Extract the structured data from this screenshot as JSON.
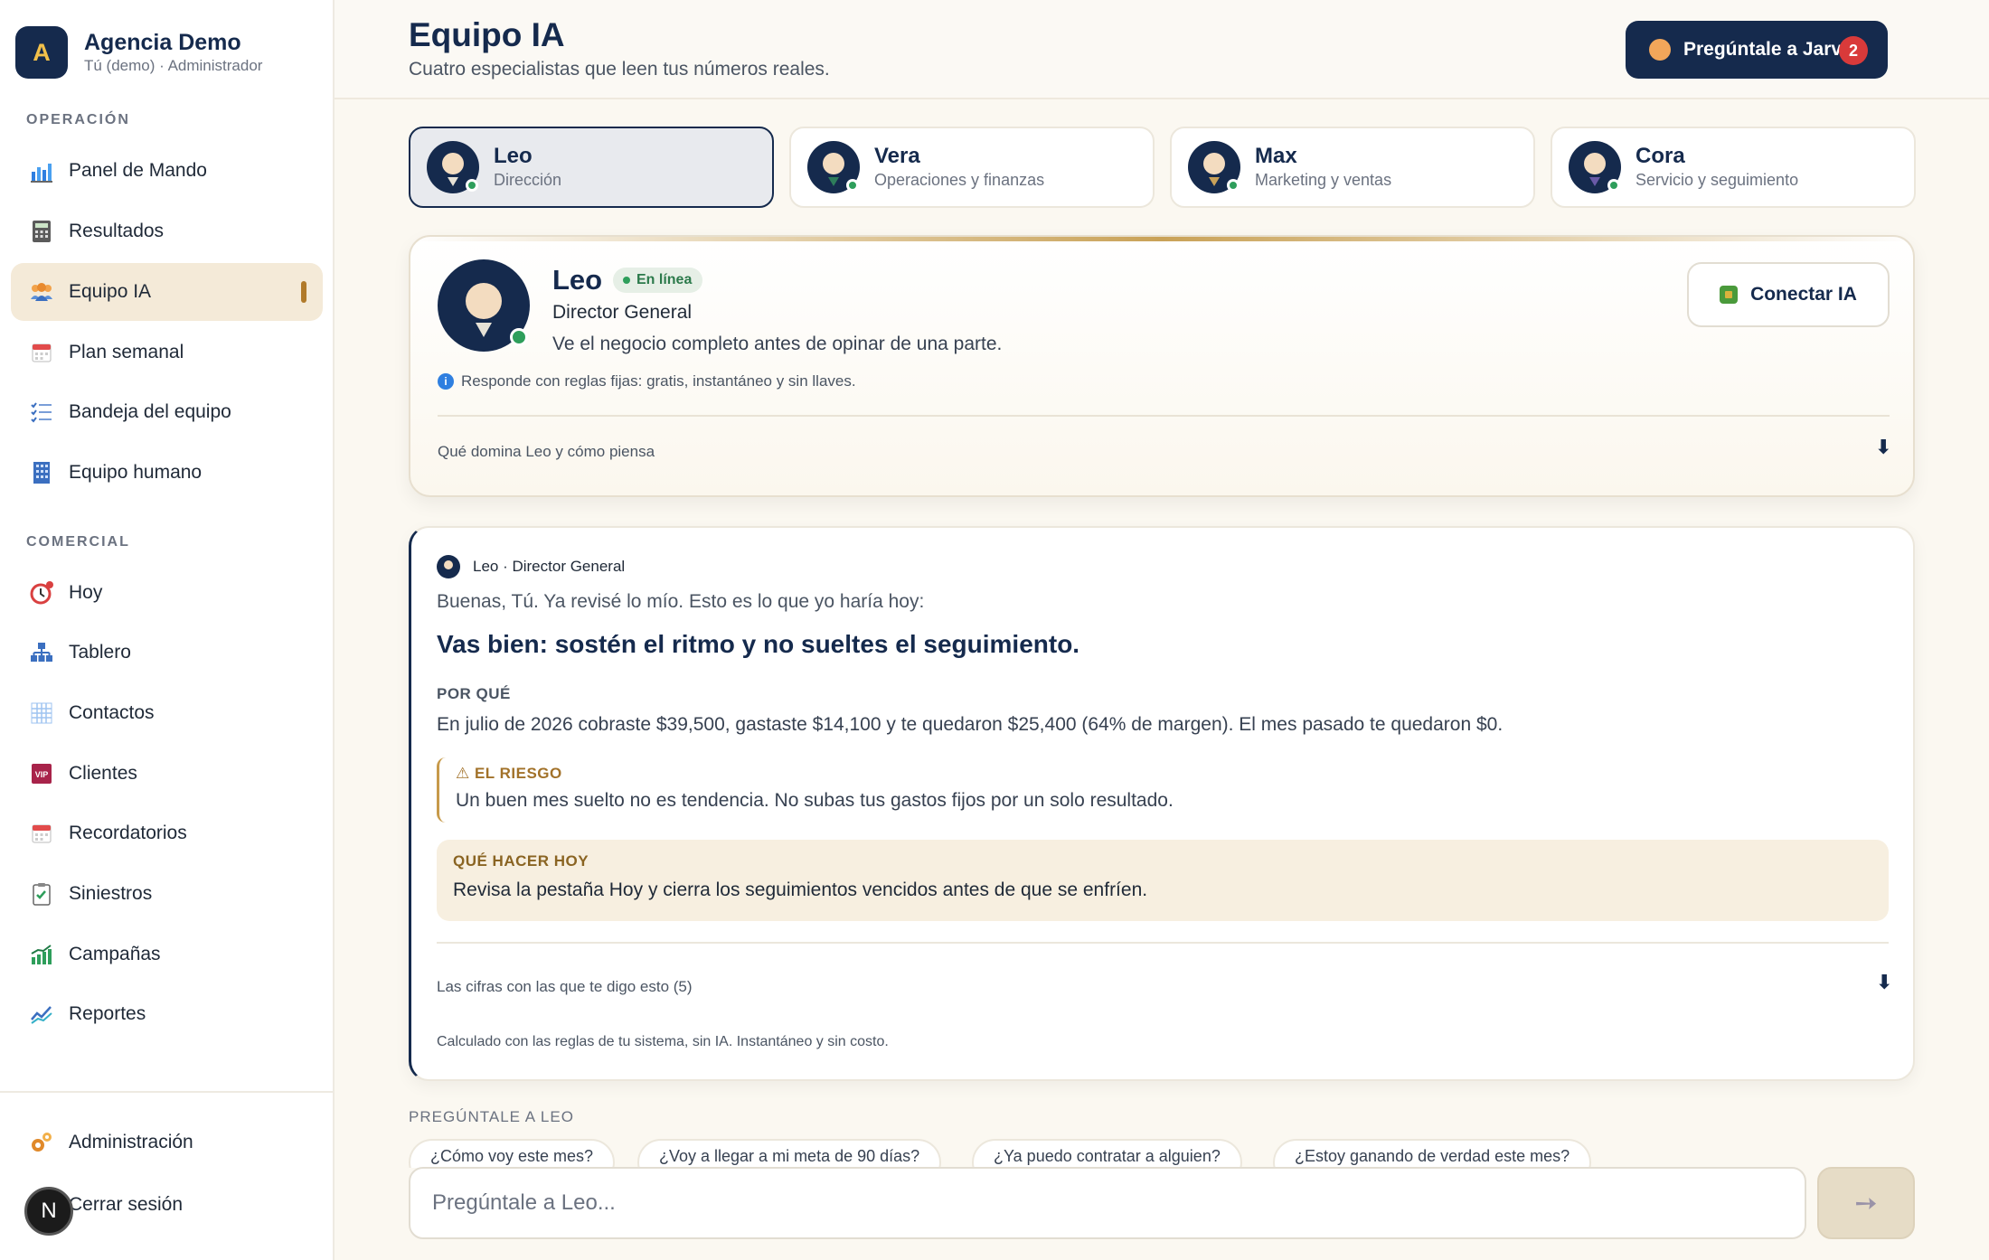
{
  "brand": {
    "logo_letter": "A",
    "name": "Agencia Demo",
    "user": "Tú (demo) · Administrador"
  },
  "sidebar": {
    "section_operacion": "OPERACIÓN",
    "section_comercial": "COMERCIAL",
    "operacion_items": [
      {
        "label": "Panel de Mando",
        "icon": "bar-chart-icon"
      },
      {
        "label": "Resultados",
        "icon": "calculator-icon"
      },
      {
        "label": "Equipo IA",
        "icon": "team-icon",
        "active": true
      },
      {
        "label": "Plan semanal",
        "icon": "calendar-icon"
      },
      {
        "label": "Bandeja del equipo",
        "icon": "checklist-icon"
      },
      {
        "label": "Equipo humano",
        "icon": "building-icon"
      }
    ],
    "comercial_items": [
      {
        "label": "Hoy",
        "icon": "alarm-clock-icon"
      },
      {
        "label": "Tablero",
        "icon": "org-chart-icon"
      },
      {
        "label": "Contactos",
        "icon": "grid-icon"
      },
      {
        "label": "Clientes",
        "icon": "vip-icon"
      },
      {
        "label": "Recordatorios",
        "icon": "calendar-icon"
      },
      {
        "label": "Siniestros",
        "icon": "clipboard-check-icon"
      },
      {
        "label": "Campañas",
        "icon": "growth-chart-icon"
      },
      {
        "label": "Reportes",
        "icon": "line-chart-icon"
      }
    ],
    "bottom": {
      "admin_label": "Administración",
      "logout_label": "Cerrar sesión",
      "avatar_letter": "N"
    }
  },
  "header": {
    "title": "Equipo IA",
    "subtitle": "Cuatro especialistas que leen tus números reales.",
    "jarvis_label": "Pregúntale a Jarvis",
    "jarvis_badge": "2"
  },
  "agents": [
    {
      "name": "Leo",
      "role": "Dirección",
      "active": true,
      "accent": "#6d8aa8"
    },
    {
      "name": "Vera",
      "role": "Operaciones y finanzas",
      "accent": "#2e7d5b"
    },
    {
      "name": "Max",
      "role": "Marketing y ventas",
      "accent": "#c9a25a"
    },
    {
      "name": "Cora",
      "role": "Servicio y seguimiento",
      "accent": "#6a5aa8"
    }
  ],
  "profile": {
    "name": "Leo",
    "status": "En línea",
    "role": "Director General",
    "description": "Ve el negocio completo antes de opinar de una parte.",
    "note": "Responde con reglas fijas: gratis, instantáneo y sin llaves.",
    "expand_label": "Qué domina Leo y cómo piensa",
    "connect_label": "Conectar IA"
  },
  "answer": {
    "author": "Leo · Director General",
    "greeting": "Buenas, Tú. Ya revisé lo mío. Esto es lo que yo haría hoy:",
    "headline": "Vas bien: sostén el ritmo y no sueltes el seguimiento.",
    "why_label": "POR QUÉ",
    "why_text": "En julio de 2026 cobraste $39,500, gastaste $14,100 y te quedaron $25,400 (64% de margen). El mes pasado te quedaron $0.",
    "risk_label": "⚠ EL RIESGO",
    "risk_text": "Un buen mes suelto no es tendencia. No subas tus gastos fijos por un solo resultado.",
    "todo_label": "QUÉ HACER HOY",
    "todo_text": "Revisa la pestaña Hoy y cierra los seguimientos vencidos antes de que se enfríen.",
    "numbers_label": "Las cifras con las que te digo esto (5)",
    "footer": "Calculado con las reglas de tu sistema, sin IA. Instantáneo y sin costo."
  },
  "ask": {
    "label": "PREGÚNTALE A LEO",
    "suggestions": [
      "¿Cómo voy este mes?",
      "¿Voy a llegar a mi meta de 90 días?",
      "¿Ya puedo contratar a alguien?",
      "¿Estoy ganando de verdad este mes?"
    ],
    "placeholder": "Pregúntale a Leo...",
    "send_icon": "arrow-right-icon"
  },
  "colors": {
    "navy": "#152a4d",
    "gold": "#c9a257",
    "online": "#2e9e5b",
    "badge": "#d93a3a"
  }
}
